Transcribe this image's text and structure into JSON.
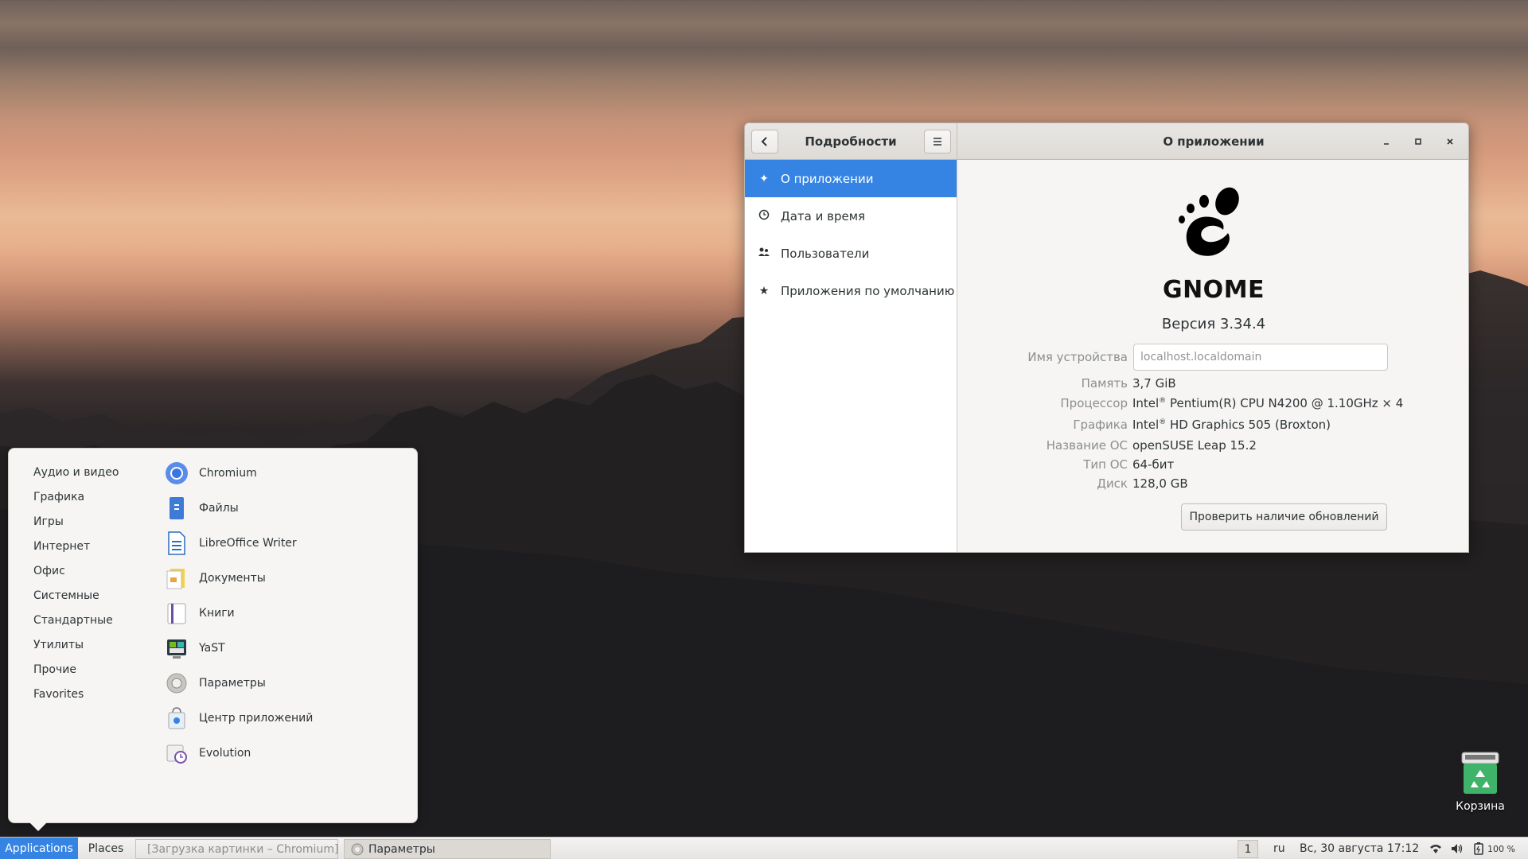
{
  "settings_window": {
    "sidebar_title": "Подробности",
    "main_title": "О приложении",
    "back_icon": "chevron-left-icon",
    "menu_icon": "hamburger-icon",
    "window_controls": [
      "minimize",
      "maximize",
      "close"
    ],
    "sidebar_items": [
      {
        "label": "О приложении",
        "icon": "star-sparkle-icon",
        "active": true
      },
      {
        "label": "Дата и время",
        "icon": "clock-icon",
        "active": false
      },
      {
        "label": "Пользователи",
        "icon": "users-icon",
        "active": false
      },
      {
        "label": "Приложения по умолчанию",
        "icon": "star-icon",
        "active": false
      }
    ],
    "about": {
      "logo_text": "GNOME",
      "version": "Версия 3.34.4",
      "device_name_label": "Имя устройства",
      "device_name_value": "localhost.localdomain",
      "memory_label": "Память",
      "memory_value": "3,7 GiB",
      "cpu_label": "Процессор",
      "cpu_brand": "Intel",
      "cpu_value": " Pentium(R) CPU N4200 @ 1.10GHz × 4",
      "graphics_label": "Графика",
      "graphics_brand": "Intel",
      "graphics_value": " HD Graphics 505 (Broxton)",
      "os_name_label": "Название ОС",
      "os_name_value": "openSUSE Leap 15.2",
      "os_type_label": "Тип ОС",
      "os_type_value": "64-бит",
      "disk_label": "Диск",
      "disk_value": "128,0 GB",
      "registered": "®",
      "update_button": "Проверить наличие обновлений"
    },
    "accent_color": "#3584e4"
  },
  "app_menu": {
    "categories": [
      "Аудио и видео",
      "Графика",
      "Игры",
      "Интернет",
      "Офис",
      "Системные",
      "Стандартные",
      "Утилиты",
      "Прочие",
      "Favorites"
    ],
    "apps": [
      {
        "label": "Chromium",
        "icon": "chromium-icon"
      },
      {
        "label": "Файлы",
        "icon": "files-icon"
      },
      {
        "label": "LibreOffice Writer",
        "icon": "writer-icon"
      },
      {
        "label": "Документы",
        "icon": "documents-icon"
      },
      {
        "label": "Книги",
        "icon": "books-icon"
      },
      {
        "label": "YaST",
        "icon": "yast-icon"
      },
      {
        "label": "Параметры",
        "icon": "settings-gear-icon"
      },
      {
        "label": "Центр приложений",
        "icon": "software-center-icon"
      },
      {
        "label": "Evolution",
        "icon": "evolution-icon"
      }
    ]
  },
  "desktop": {
    "trash_label": "Корзина",
    "trash_icon": "trash-icon"
  },
  "panel": {
    "applications": "Applications",
    "places": "Places",
    "tasks": [
      {
        "label": "[Загрузка картинки – Chromium]",
        "icon": "chromium-icon"
      },
      {
        "label": "Параметры",
        "icon": "settings-gear-icon"
      }
    ],
    "workspace": "1",
    "keyboard_layout": "ru",
    "datetime": "Вс, 30 августа  17:12",
    "battery": "100 %",
    "tray_icons": [
      "wifi-icon",
      "volume-icon",
      "battery-icon"
    ]
  }
}
